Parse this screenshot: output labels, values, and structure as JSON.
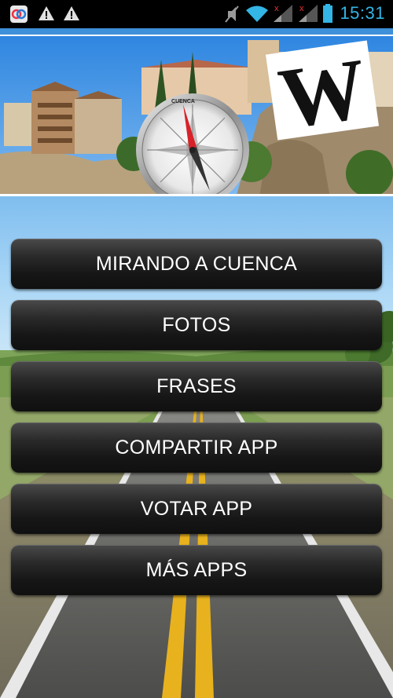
{
  "status_bar": {
    "time": "15:31",
    "icons": [
      "sync-app-icon",
      "warning-icon",
      "warning-icon",
      "mute-icon",
      "wifi-icon",
      "signal-no-service-icon",
      "signal-no-service-icon",
      "battery-icon"
    ],
    "time_color": "#33b5e5"
  },
  "header": {
    "compass_label": "CUENCA",
    "logo_letter": "W"
  },
  "menu": {
    "items": [
      {
        "label": "MIRANDO A CUENCA"
      },
      {
        "label": "FOTOS"
      },
      {
        "label": "FRASES"
      },
      {
        "label": "COMPARTIR APP"
      },
      {
        "label": "VOTAR APP"
      },
      {
        "label": "MÁS APPS"
      }
    ]
  }
}
